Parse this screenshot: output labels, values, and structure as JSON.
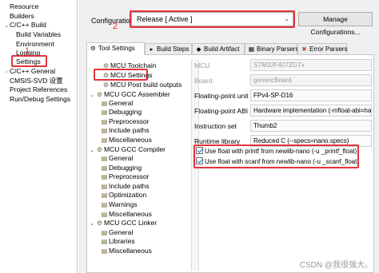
{
  "left_nav": {
    "items": [
      {
        "label": "Resource",
        "expander": ""
      },
      {
        "label": "Builders",
        "expander": ""
      },
      {
        "label": "C/C++ Build",
        "expander": "⌄"
      },
      {
        "label": "Build Variables",
        "expander": ""
      },
      {
        "label": "Environment",
        "expander": ""
      },
      {
        "label": "Logging",
        "expander": ""
      },
      {
        "label": "Settings",
        "expander": ""
      },
      {
        "label": "C/C++ General",
        "expander": "›"
      },
      {
        "label": "CMSIS-SVD 设置",
        "expander": ""
      },
      {
        "label": "Project References",
        "expander": ""
      },
      {
        "label": "Run/Debug Settings",
        "expander": ""
      }
    ],
    "annotation_number": "1"
  },
  "config": {
    "label": "Configuration:",
    "selected": "Release  [ Active ]",
    "manage_label": "Manage Configurations...",
    "annotation_number": "2"
  },
  "tabs": [
    {
      "label": "Tool Settings",
      "icon": "tool-settings-icon",
      "glyph": "⚙"
    },
    {
      "label": "Build Steps",
      "icon": "build-steps-icon",
      "glyph": "▸"
    },
    {
      "label": "Build Artifact",
      "icon": "build-artifact-icon",
      "glyph": "◆"
    },
    {
      "label": "Binary Parsers",
      "icon": "binary-parsers-icon",
      "glyph": "▦"
    },
    {
      "label": "Error Parsers",
      "icon": "error-parsers-icon",
      "glyph": "✖"
    }
  ],
  "tool_tree": [
    {
      "label": "MCU Toolchain",
      "exp": "",
      "icon": "⚙"
    },
    {
      "label": "MCU Settings",
      "exp": "",
      "icon": "⚙"
    },
    {
      "label": "MCU Post build outputs",
      "exp": "",
      "icon": "⚙"
    },
    {
      "label": "MCU GCC Assembler",
      "exp": "⌄",
      "icon": "⚙"
    },
    {
      "label": "General",
      "exp": "",
      "icon": "▤"
    },
    {
      "label": "Debugging",
      "exp": "",
      "icon": "▤"
    },
    {
      "label": "Preprocessor",
      "exp": "",
      "icon": "▤"
    },
    {
      "label": "Include paths",
      "exp": "",
      "icon": "▤"
    },
    {
      "label": "Miscellaneous",
      "exp": "",
      "icon": "▤"
    },
    {
      "label": "MCU GCC Compiler",
      "exp": "⌄",
      "icon": "⚙"
    },
    {
      "label": "General",
      "exp": "",
      "icon": "▤"
    },
    {
      "label": "Debugging",
      "exp": "",
      "icon": "▤"
    },
    {
      "label": "Preprocessor",
      "exp": "",
      "icon": "▤"
    },
    {
      "label": "Include paths",
      "exp": "",
      "icon": "▤"
    },
    {
      "label": "Optimization",
      "exp": "",
      "icon": "▤"
    },
    {
      "label": "Warnings",
      "exp": "",
      "icon": "▤"
    },
    {
      "label": "Miscellaneous",
      "exp": "",
      "icon": "▤"
    },
    {
      "label": "MCU GCC Linker",
      "exp": "⌄",
      "icon": "⚙"
    },
    {
      "label": "General",
      "exp": "",
      "icon": "▤"
    },
    {
      "label": "Libraries",
      "exp": "",
      "icon": "▤"
    },
    {
      "label": "Miscellaneous",
      "exp": "",
      "icon": "▤"
    }
  ],
  "settings": {
    "rows": [
      {
        "label": "MCU",
        "value": "STM32F407ZGTx"
      },
      {
        "label": "Board",
        "value": "genericBoard"
      },
      {
        "label": "Floating-point unit",
        "value": "FPv4-SP-D16"
      },
      {
        "label": "Floating-point ABI",
        "value": "Hardware implementation (-mfloat-abi=ha"
      },
      {
        "label": "Instruction set",
        "value": "Thumb2"
      },
      {
        "label": "Runtime library",
        "value": "Reduced C (--specs=nano.specs)"
      }
    ],
    "checkboxes": [
      {
        "label": "Use float with printf from newlib-nano (-u _printf_float)",
        "checked": true
      },
      {
        "label": "Use float with scanf from newlib-nano (-u _scanf_float)",
        "checked": true
      }
    ]
  },
  "watermark": "CSDN @我很强大。",
  "colors": {
    "annotation": "#e3343c",
    "check": "#1f5fbf"
  }
}
